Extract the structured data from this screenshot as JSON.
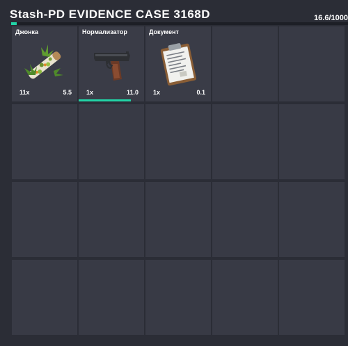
{
  "stash": {
    "title": "Stash-PD EVIDENCE CASE 3168D",
    "weight_text": "16.6/1000",
    "fill_fraction": 0.0166,
    "accent_color": "#22d3a6"
  },
  "items": [
    {
      "name": "Джонка",
      "icon": "joint-icon",
      "count": "11x",
      "weight": "5.5"
    },
    {
      "name": "Нормализатор",
      "icon": "pistol-icon",
      "count": "1x",
      "weight": "11.0",
      "durability_fraction": 0.8
    },
    {
      "name": "Документ",
      "icon": "clipboard-document-icon",
      "count": "1x",
      "weight": "0.1"
    }
  ],
  "grid": {
    "columns": 5,
    "rows": 4
  }
}
